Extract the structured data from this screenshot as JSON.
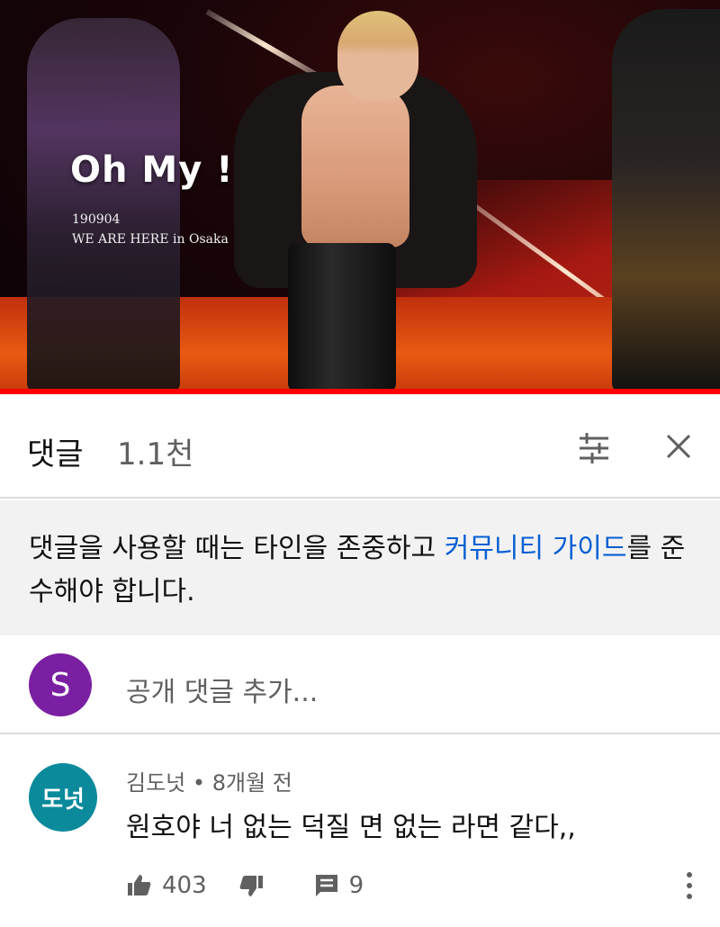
{
  "video": {
    "overlay_title": "Oh My !",
    "overlay_date": "190904",
    "overlay_location": "WE ARE HERE in Osaka",
    "progress_fraction": 1.0,
    "accent_color": "#ff0000"
  },
  "comments_header": {
    "title": "댓글",
    "count": "1.1천",
    "sort_icon": "sort-icon",
    "close_icon": "close-icon"
  },
  "guideline": {
    "text_before": "댓글을 사용할 때는 타인을 존중하고 ",
    "link_text": "커뮤니티 가이드",
    "text_after": "를 준수해야 합니다."
  },
  "add_comment": {
    "avatar_letter": "S",
    "avatar_color": "#7b1fa2",
    "placeholder": "공개 댓글 추가..."
  },
  "comments": [
    {
      "avatar_text": "도넛",
      "avatar_color": "#0a8a9b",
      "author": "김도넛",
      "separator": "•",
      "time": "8개월 전",
      "text": "원호야 너 없는 덕질 면 없는 라면 같다,,",
      "likes": "403",
      "replies": "9"
    }
  ]
}
